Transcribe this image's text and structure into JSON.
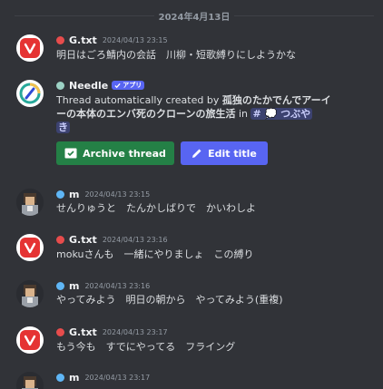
{
  "date_divider": "2024年4月13日",
  "messages": [
    {
      "user": "G.txt",
      "time": "2024/04/13 23:15",
      "text": "明日はごろ鯖内の会話　川柳・短歌縛りにしようかな"
    },
    {
      "user": "Needle",
      "badge": "アプリ",
      "text_prefix": "Thread automatically created by ",
      "text_author": "孤独のたかでんでアーイ",
      "text_author_cont": "ーの本体のエンバ死のクローンの旅生活",
      "text_in": " in ",
      "mention_hash": "#",
      "mention_name": "💭 つぶや",
      "mention_name_cont": "き",
      "buttons": {
        "archive": "Archive thread",
        "edit": "Edit title"
      }
    },
    {
      "user": "m",
      "time": "2024/04/13 23:15",
      "text": "せんりゅうと　たんかしばりで　かいわしよ"
    },
    {
      "user": "G.txt",
      "time": "2024/04/13 23:16",
      "text": "mokuさんも　一緒にやりましょ　この縛り"
    },
    {
      "user": "m",
      "time": "2024/04/13 23:16",
      "text": "やってみよう　明日の朝から　やってみよう(重複)"
    },
    {
      "user": "G.txt",
      "time": "2024/04/13 23:17",
      "text": "もう今も　すでにやってる　フライング"
    },
    {
      "user": "m",
      "time": "2024/04/13 23:17",
      "text": ""
    }
  ],
  "colors": {
    "background": "#313338",
    "role_red": "#e74c4c",
    "role_blue": "#5fb6f5",
    "archive_button": "#248046",
    "edit_button": "#5865f2"
  },
  "icons": [
    "vivaldi-logo-icon",
    "needle-logo-icon",
    "archive-icon",
    "pencil-icon",
    "verified-check-icon"
  ]
}
